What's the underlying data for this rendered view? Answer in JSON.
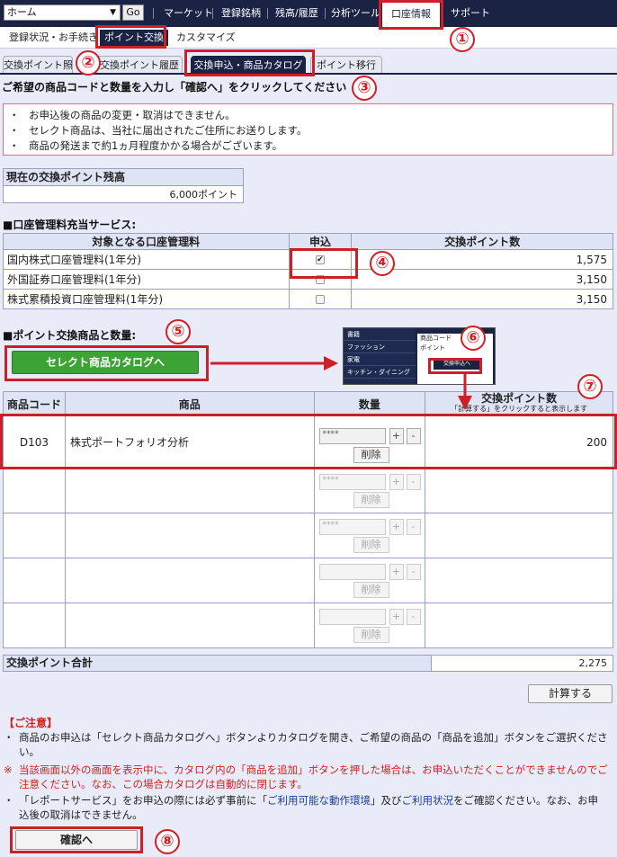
{
  "topnav": {
    "select_value": "ホーム",
    "go_label": "Go",
    "links": [
      "マーケット",
      "登録銘柄",
      "残高/履歴",
      "分析ツール"
    ],
    "active": "口座情報",
    "support": "サポート"
  },
  "subnav": {
    "items": [
      "登録状況・お手続き",
      "ポイント交換",
      "カスタマイズ"
    ]
  },
  "tabs": [
    "交換ポイント照会",
    "交換ポイント履歴",
    "交換申込・商品カタログ",
    "ポイント移行"
  ],
  "instruction": "ご希望の商品コードと数量を入力し「確認へ」をクリックしてください",
  "notices": [
    "お申込後の商品の変更・取消はできません。",
    "セレクト商品は、当社に届出されたご住所にお送りします。",
    "商品の発送まで約1ヵ月程度かかる場合がございます。"
  ],
  "balance": {
    "title": "現在の交換ポイント残高",
    "value": "6,000ポイント"
  },
  "fee_section": {
    "title": "■口座管理料充当サービス:",
    "headers": [
      "対象となる口座管理料",
      "申込",
      "交換ポイント数"
    ],
    "rows": [
      {
        "name": "国内株式口座管理料(1年分)",
        "checked": true,
        "points": "1,575"
      },
      {
        "name": "外国証券口座管理料(1年分)",
        "checked": false,
        "points": "3,150"
      },
      {
        "name": "株式累積投資口座管理料(1年分)",
        "checked": false,
        "points": "3,150"
      }
    ]
  },
  "product_section": {
    "title": "■ポイント交換商品と数量:",
    "catalog_button": "セレクト商品カタログへ",
    "thumb": {
      "menu": [
        "書籍",
        "ファッション",
        "家電",
        "キッチン・ダイニング"
      ],
      "fields": [
        "商品コード",
        "ポイント"
      ],
      "button": "交換申込へ"
    },
    "headers": [
      "商品コード",
      "商品",
      "数量",
      "交換ポイント数",
      "「計算する」をクリックすると表示します"
    ],
    "qty_placeholder": "****",
    "delete_label": "削除",
    "plus": "+",
    "minus": "-",
    "rows": [
      {
        "code": "D103",
        "name": "株式ポートフォリオ分析",
        "qty": "****",
        "points": "200"
      },
      {
        "code": "",
        "name": "",
        "qty": "****",
        "points": ""
      },
      {
        "code": "",
        "name": "",
        "qty": "****",
        "points": ""
      },
      {
        "code": "",
        "name": "",
        "qty": "",
        "points": ""
      },
      {
        "code": "",
        "name": "",
        "qty": "",
        "points": ""
      }
    ]
  },
  "total": {
    "label": "交換ポイント合計",
    "value": "2,275"
  },
  "calc_button": "計算する",
  "caution": {
    "title": "【ご注意】",
    "note1": "商品のお申込は「セレクト商品カタログへ」ボタンよりカタログを開き、ご希望の商品の「商品を追加」ボタンをご選択ください。",
    "note2": "当該画面以外の画面を表示中に、カタログ内の「商品を追加」ボタンを押した場合は、お申込いただくことができませんのでご注意ください。なお、この場合カタログは自動的に閉じます。",
    "note3_pre": "「レポートサービス」をお申込の際には必ず事前に「",
    "note3_link1": "ご利用可能な動作環境",
    "note3_mid": "」及び",
    "note3_link2": "ご利用状況",
    "note3_post": "をご確認ください。なお、お申込後の取消はできません。"
  },
  "confirm_button": "確認へ",
  "callouts": [
    "①",
    "②",
    "③",
    "④",
    "⑤",
    "⑥",
    "⑦",
    "⑧"
  ],
  "colors": {
    "navy": "#1a2344",
    "highlight_red": "#cc1f2a",
    "catalog_green": "#3ca435"
  }
}
